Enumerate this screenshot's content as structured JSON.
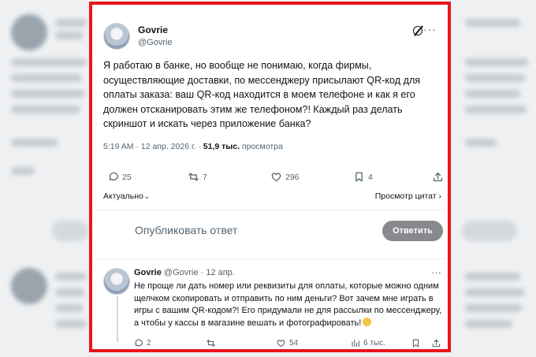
{
  "tweet": {
    "author_name": "Govrie",
    "author_handle": "@Govrie",
    "text": "Я работаю в банке, но вообще не понимаю, когда фирмы, осуществляющие доставки, по мессенджеру присылают QR-код для оплаты заказа: ваш QR-код находится в моем телефоне и как я его должен отсканировать этим же телефоном?! Каждый раз делать скриншот и искать через приложение банка?",
    "time": "5:19 AM",
    "date": "12 апр. 2026 г.",
    "views": "51,9 тыс.",
    "views_label": "просмотра",
    "replies": "25",
    "reposts": "7",
    "likes": "296",
    "bookmarks": "4"
  },
  "sort": {
    "left_label": "Актуально",
    "right_label": "Просмотр цитат"
  },
  "reply_box": {
    "placeholder": "Опубликовать ответ",
    "button": "Ответить"
  },
  "reply": {
    "author_name": "Govrie",
    "author_handle": "@Govrie",
    "date": "12 апр.",
    "text": "Не проще ли дать номер или реквизиты для оплаты, которые можно одним щелчком скопировать и отправить по ним деньги? Вот зачем мне играть в игры с вашим QR-кодом?! Его придумали не для рассылки по мессенджеру, а чтобы у кассы в магазине вешать и фотографировать!",
    "replies": "2",
    "reposts": "",
    "likes": "54",
    "views": "6 тыс."
  },
  "colors": {
    "frame": "#e8161b",
    "muted": "#536471",
    "reply_button": "#87898c"
  }
}
